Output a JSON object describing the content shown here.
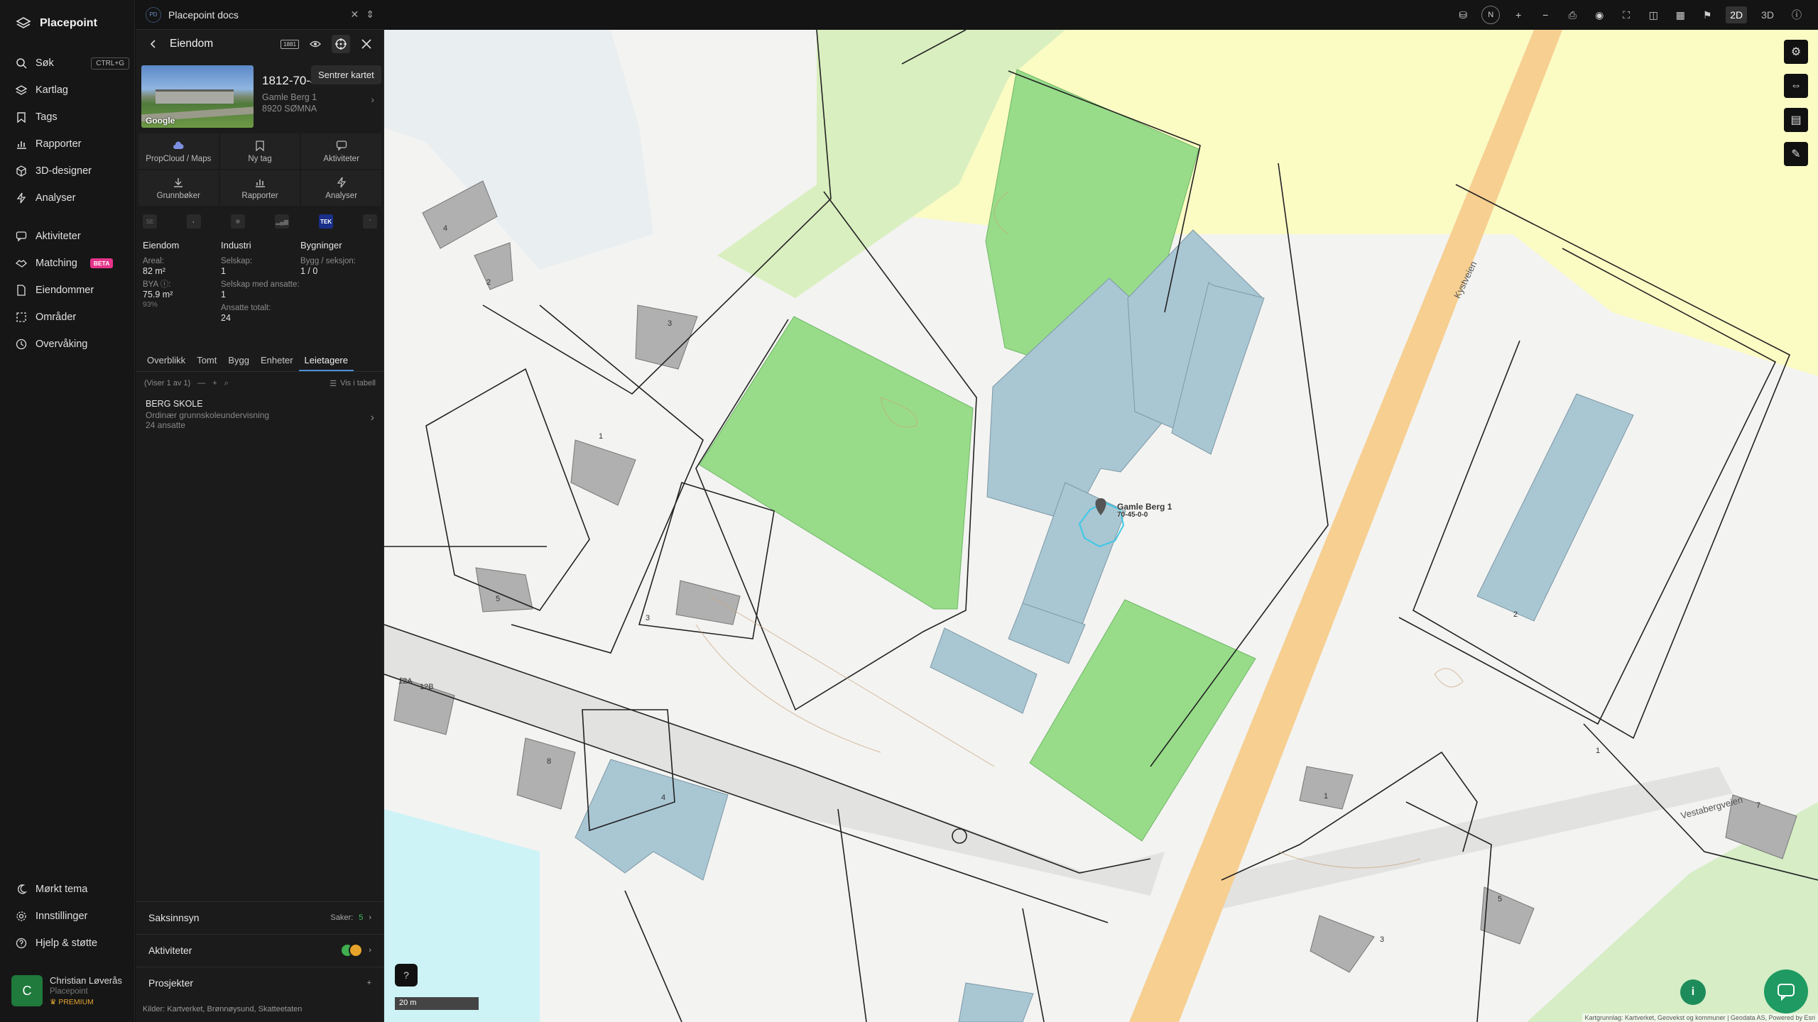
{
  "app": {
    "brand": "Placepoint"
  },
  "nav": {
    "search_label": "Søk",
    "search_shortcut": "CTRL+G",
    "items_top": [
      {
        "label": "Kartlag",
        "icon": "layers-icon"
      },
      {
        "label": "Tags",
        "icon": "bookmark-icon"
      },
      {
        "label": "Rapporter",
        "icon": "bar-chart-icon"
      },
      {
        "label": "3D-designer",
        "icon": "cube-icon"
      },
      {
        "label": "Analyser",
        "icon": "lightning-icon"
      }
    ],
    "items_mid": [
      {
        "label": "Aktiviteter",
        "icon": "message-icon"
      },
      {
        "label": "Matching",
        "icon": "handshake-icon",
        "badge": "BETA"
      },
      {
        "label": "Eiendommer",
        "icon": "document-icon"
      },
      {
        "label": "Områder",
        "icon": "area-icon"
      },
      {
        "label": "Overvåking",
        "icon": "clock-icon"
      }
    ],
    "items_bottom": [
      {
        "label": "Mørkt tema",
        "icon": "moon-icon"
      },
      {
        "label": "Innstillinger",
        "icon": "gear-icon"
      },
      {
        "label": "Hjelp & støtte",
        "icon": "help-icon"
      }
    ],
    "user": {
      "initial": "C",
      "name": "Christian Løverås",
      "org": "Placepoint",
      "plan": "PREMIUM"
    }
  },
  "panel": {
    "docs": {
      "badge": "PD",
      "title": "Placepoint docs"
    },
    "header": {
      "title": "Eiendom",
      "badge_1881": "1881",
      "tooltip": "Sentrer kartet"
    },
    "property": {
      "id": "1812-70-45-0-0",
      "address": "Gamle Berg 1",
      "postal": "8920 SØMNA",
      "thumb_label": "Google"
    },
    "actions": [
      {
        "label": "PropCloud / Maps",
        "icon": "cloud-icon"
      },
      {
        "label": "Ny tag",
        "icon": "tag-icon"
      },
      {
        "label": "Aktiviteter",
        "icon": "message-icon"
      },
      {
        "label": "Grunnbøker",
        "icon": "download-icon"
      },
      {
        "label": "Rapporter",
        "icon": "bar-chart-icon"
      },
      {
        "label": "Analyser",
        "icon": "lightning-icon"
      }
    ],
    "sources": [
      {
        "name": "se-source-icon",
        "text": "SE"
      },
      {
        "name": "globe-source-icon",
        "text": ""
      },
      {
        "name": "agriculture-source-icon",
        "text": ""
      },
      {
        "name": "statistics-source-icon",
        "text": ""
      },
      {
        "name": "tek-source-icon",
        "text": "TEK"
      },
      {
        "name": "more-source-icon",
        "text": ""
      }
    ],
    "stats": {
      "eiendom": {
        "heading": "Eiendom",
        "areal_label": "Areal:",
        "areal_value": "82 m²",
        "bya_label": "BYA ⓘ:",
        "bya_value": "75.9 m²",
        "bya_pct": "93%"
      },
      "industri": {
        "heading": "Industri",
        "selskap_label": "Selskap:",
        "selskap_value": "1",
        "med_label": "Selskap med ansatte:",
        "med_value": "1",
        "ansatte_label": "Ansatte totalt:",
        "ansatte_value": "24"
      },
      "bygninger": {
        "heading": "Bygninger",
        "bygg_label": "Bygg / seksjon:",
        "bygg_value": "1 / 0"
      }
    },
    "tabs": [
      "Overblikk",
      "Tomt",
      "Bygg",
      "Enheter",
      "Leietagere"
    ],
    "active_tab": 4,
    "list": {
      "count": "(Viser 1 av 1)",
      "table_link": "Vis i tabell"
    },
    "tenants": [
      {
        "name": "BERG SKOLE",
        "desc": "Ordinær grunnskoleundervisning",
        "emp": "24 ansatte"
      }
    ],
    "sections": {
      "saksinnsyn": {
        "label": "Saksinnsyn",
        "count_label": "Saker:",
        "count": "5"
      },
      "aktiviteter": {
        "label": "Aktiviteter"
      },
      "prosjekter": {
        "label": "Prosjekter",
        "add": "+"
      }
    },
    "footer": {
      "label": "Kilder:",
      "sources": "Kartverket, Brønnøysund, Skatteetaten"
    }
  },
  "map": {
    "scale": "20 m",
    "pin_label_1": "Gamle Berg 1",
    "pin_label_2": "70-45-0-0",
    "road_1": "Kystveien",
    "road_2": "Vestabergveien",
    "attribution": "Kartgrunnlag: Kartverket, Geovekst og kommuner | Geodata AS, Powered by Esri",
    "view_2d": "2D",
    "view_3d": "3D",
    "compass": "N",
    "house_numbers": [
      "4",
      "2",
      "3",
      "1",
      "5",
      "3",
      "12A",
      "12B",
      "8",
      "4",
      "1",
      "1",
      "7",
      "5",
      "3",
      "2"
    ],
    "colors": {
      "park": "#98dc8a",
      "building": "#a9c6d3",
      "road": "#f5cf8f",
      "yellow_zone": "#fbfbc2",
      "water": "#cdf2f6"
    }
  }
}
